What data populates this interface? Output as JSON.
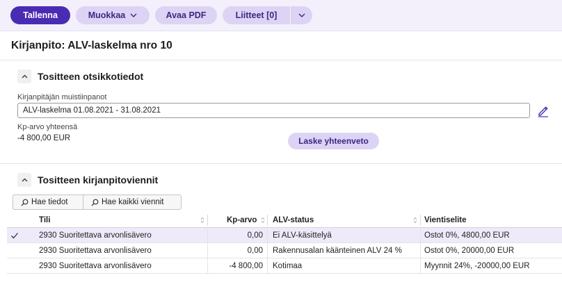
{
  "toolbar": {
    "save_label": "Tallenna",
    "edit_label": "Muokkaa",
    "pdf_label": "Avaa PDF",
    "attachments_label": "Liitteet [0]"
  },
  "page": {
    "title": "Kirjanpito: ALV-laskelma nro 10"
  },
  "header_section": {
    "title": "Tositteen otsikkotiedot",
    "notes_label": "Kirjanpitäjän muistiinpanot",
    "notes_value": "ALV-laskelma 01.08.2021 - 31.08.2021",
    "total_label": "Kp-arvo yhteensä",
    "total_value": "-4 800,00 EUR",
    "calc_button": "Laske yhteenveto"
  },
  "entries_section": {
    "title": "Tositteen kirjanpitoviennit",
    "fetch_button": "Hae tiedot",
    "fetch_all_button": "Hae kaikki viennit",
    "columns": {
      "account": "Tili",
      "amount": "Kp-arvo",
      "vat_status": "ALV-status",
      "description": "Vientiselite"
    },
    "rows": [
      {
        "account": "2930 Suoritettava arvonlisävero",
        "amount": "0,00",
        "vat_status": "Ei ALV-käsittelyä",
        "description": "Ostot 0%, 4800,00 EUR",
        "selected": true
      },
      {
        "account": "2930 Suoritettava arvonlisävero",
        "amount": "0,00",
        "vat_status": "Rakennusalan käänteinen ALV 24 %",
        "description": "Ostot 0%, 20000,00 EUR",
        "selected": false
      },
      {
        "account": "2930 Suoritettava arvonlisävero",
        "amount": "-4 800,00",
        "vat_status": "Kotimaa",
        "description": "Myynnit 24%, -20000,00 EUR",
        "selected": false
      }
    ]
  },
  "colors": {
    "primary": "#4a2bb3",
    "secondary": "#ddd3f5",
    "toolbar_bg": "#f3f0fb",
    "selected_row": "#efeaf9"
  }
}
